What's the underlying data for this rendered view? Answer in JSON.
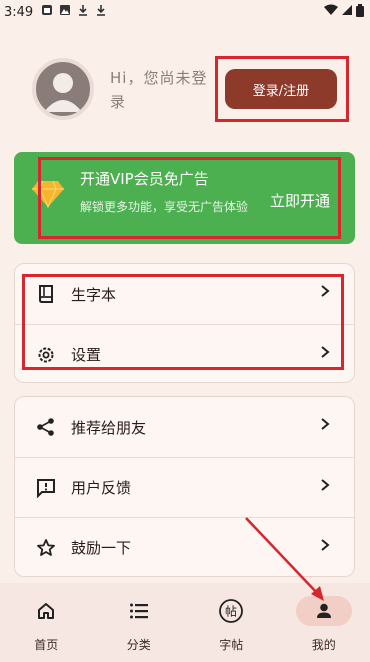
{
  "status_bar": {
    "time": "3:49"
  },
  "profile": {
    "greeting": "Hi，您尚未登录",
    "login_label": "登录/注册"
  },
  "vip": {
    "title": "开通VIP会员免广告",
    "subtitle": "解锁更多功能，享受无广告体验",
    "cta": "立即开通"
  },
  "menu_primary": [
    {
      "label": "生字本",
      "icon": "book-icon"
    },
    {
      "label": "设置",
      "icon": "gear-icon"
    }
  ],
  "menu_secondary": [
    {
      "label": "推荐给朋友",
      "icon": "share-icon"
    },
    {
      "label": "用户反馈",
      "icon": "feedback-icon"
    },
    {
      "label": "鼓励一下",
      "icon": "star-icon"
    }
  ],
  "bottom_nav": [
    {
      "label": "首页",
      "icon": "home-icon",
      "active": false
    },
    {
      "label": "分类",
      "icon": "list-icon",
      "active": false
    },
    {
      "label": "字帖",
      "icon": "copybook-icon",
      "active": false
    },
    {
      "label": "我的",
      "icon": "person-icon",
      "active": true
    }
  ],
  "colors": {
    "background": "#fbefea",
    "accent": "#8d3a2b",
    "vip_green": "#4caf50",
    "annotation_red": "#d7262e",
    "nav_active": "#f2cfc6"
  }
}
